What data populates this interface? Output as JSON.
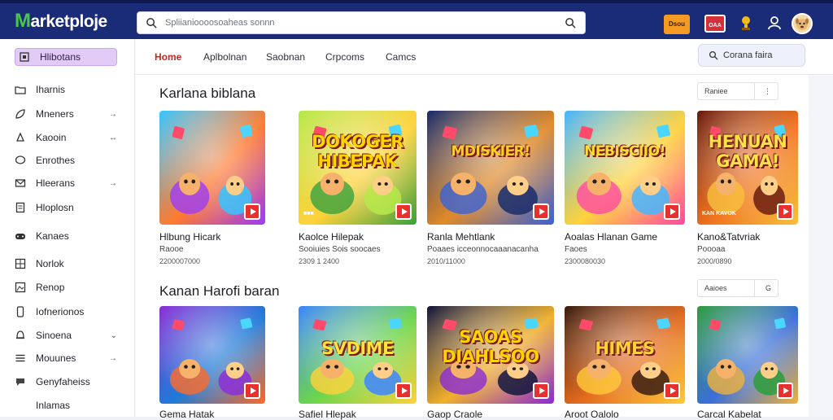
{
  "app": {
    "logo_mark": "M",
    "logo_text": "arketploje"
  },
  "search": {
    "placeholder": "Spliianioooosoaheas sonnn"
  },
  "topbar": {
    "orange_label": "Dsou",
    "red_label": "OAA"
  },
  "sidebar": {
    "items": [
      {
        "label": "Hlibotans",
        "icon": "grid-icon",
        "chevron": ""
      },
      {
        "label": "Iharnis",
        "icon": "folder-icon",
        "chevron": ""
      },
      {
        "label": "Mneners",
        "icon": "leaf-icon",
        "chevron": "→"
      },
      {
        "label": "Kaooin",
        "icon": "drop-icon",
        "chevron": "↔"
      },
      {
        "label": "Enrothes",
        "icon": "chat-icon",
        "chevron": ""
      },
      {
        "label": "Hleerans",
        "icon": "mail-icon",
        "chevron": "→"
      },
      {
        "label": "Hloplosn",
        "icon": "document-icon",
        "chevron": ""
      },
      {
        "label": "Kanaes",
        "icon": "gamepad-icon",
        "chevron": ""
      },
      {
        "label": "Norlok",
        "icon": "table-icon",
        "chevron": ""
      },
      {
        "label": "Renop",
        "icon": "image-icon",
        "chevron": ""
      },
      {
        "label": "Iofnerionos",
        "icon": "phone-icon",
        "chevron": ""
      },
      {
        "label": "Sinoena",
        "icon": "bell-icon",
        "chevron": "⌄"
      },
      {
        "label": "Mouunes",
        "icon": "menu-icon",
        "chevron": "→"
      },
      {
        "label": "Genyfaheiss",
        "icon": "speech-icon",
        "chevron": ""
      },
      {
        "label": "Inlamas",
        "icon": "",
        "chevron": ""
      }
    ]
  },
  "nav": {
    "tabs": [
      "Home",
      "Aplbolnan",
      "Saobnan",
      "Crpcoms",
      "Camcs"
    ],
    "chip": "Corana faira"
  },
  "sections": [
    {
      "title": "Karlana biblana",
      "control": "Raniee",
      "control_dot": "⋮",
      "cards": [
        {
          "title": "Hlbung Hicark",
          "sub": "Raooe",
          "meta": "2200007000",
          "art": "",
          "label": ""
        },
        {
          "title": "Kaolce Hilepak",
          "sub": "Sooiuies Sois soocaes",
          "meta": "2309 1 2400",
          "art": "DOKOGER HIBEPAK",
          "label": "■■■"
        },
        {
          "title": "Ranla Mehtlank",
          "sub": "Poaaes icceonnocaaanacanha",
          "meta": "2010/11000",
          "art": "MDISKIER!",
          "label": ""
        },
        {
          "title": "Aoalas Hlanan Game",
          "sub": "Faoes",
          "meta": "2300080030",
          "art": "NEBISCIIO!",
          "label": ""
        },
        {
          "title": "Kano&Tatvriak",
          "sub": "Poooaa",
          "meta": "2000/0890",
          "art": "HENUAN GAMA!",
          "label": "KAN KAVOK"
        }
      ]
    },
    {
      "title": "Kanan Harofi baran",
      "control": "Aaioes",
      "control_dot": "G",
      "cards": [
        {
          "title": "Gema Hatak",
          "sub": "",
          "meta": "",
          "art": "",
          "label": ""
        },
        {
          "title": "Safiel Hlepak",
          "sub": "",
          "meta": "",
          "art": "SVDIME",
          "label": ""
        },
        {
          "title": "Gaop Craole",
          "sub": "",
          "meta": "",
          "art": "SAOAS DIAHLSOO",
          "label": ""
        },
        {
          "title": "Aroot Oalolo",
          "sub": "",
          "meta": "",
          "art": "HIMES",
          "label": ""
        },
        {
          "title": "Carcal Kabelat",
          "sub": "",
          "meta": "",
          "art": "",
          "label": ""
        }
      ]
    }
  ],
  "colors": {
    "topbar": "#1a2b78",
    "accent_red": "#c4281f",
    "active_side": "#e2ccf6",
    "play": "#e8312c"
  }
}
